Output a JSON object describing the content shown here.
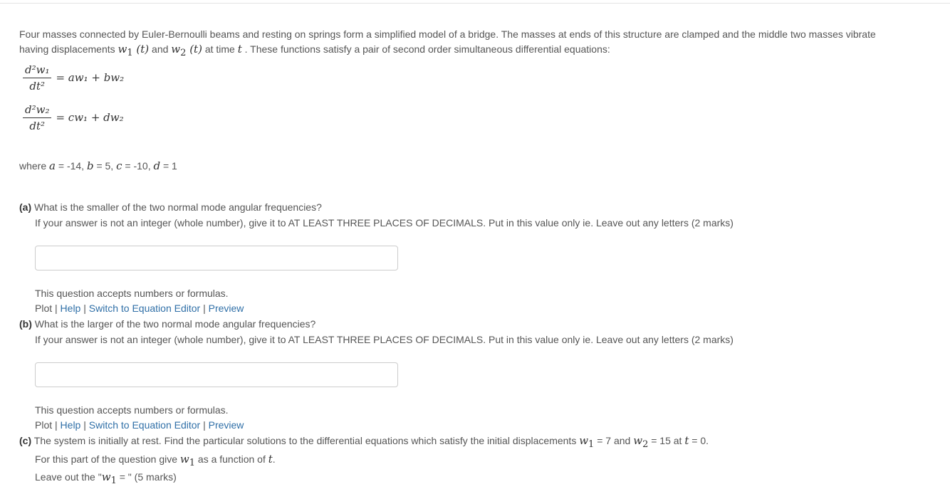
{
  "intro": {
    "line1": "Four masses connected by Euler-Bernoulli beams and resting on springs form a simplified model of a bridge. The masses at ends of this structure are clamped and the middle two masses vibrate",
    "line2_a": "having displacements ",
    "w1t": "w",
    "and": " and ",
    "at_time": " at time ",
    "t_var": "t",
    "line2_end": " . These functions satisfy a pair of second order simultaneous differential equations:"
  },
  "equations": [
    {
      "num": "d²w₁",
      "den": "dt²",
      "rhs": "= aw₁ + bw₂"
    },
    {
      "num": "d²w₂",
      "den": "dt²",
      "rhs": "= cw₁ + dw₂"
    }
  ],
  "where": {
    "prefix": "where ",
    "a_var": "a",
    "a_val": " = -14, ",
    "b_var": "b",
    "b_val": " = 5, ",
    "c_var": "c",
    "c_val": " = -10, ",
    "d_var": "d",
    "d_val": " = 1"
  },
  "part_a": {
    "label": "(a)",
    "question": " What is the smaller of the two normal mode angular frequencies?",
    "instruction": "If your answer is not an integer (whole number), give it to AT LEAST THREE PLACES OF DECIMALS. Put in this value only ie. Leave out any letters (2 marks)",
    "input_value": "",
    "hint": "This question accepts numbers or formulas."
  },
  "part_b": {
    "label": "(b)",
    "question": " What is the larger of the two normal mode angular frequencies?",
    "instruction": "If your answer is not an integer (whole number), give it to AT LEAST THREE PLACES OF DECIMALS. Put in this value only ie. Leave out any letters (2 marks)",
    "input_value": "",
    "hint": "This question accepts numbers or formulas."
  },
  "links": {
    "plot": "Plot",
    "help": "Help",
    "switch": "Switch to Equation Editor",
    "preview": "Preview",
    "sep": " | "
  },
  "part_c": {
    "label": "(c)",
    "question_a": " The system is initially at rest. Find the particular solutions to the differential equations which satisfy the initial displacements ",
    "w1": "w",
    "eq7": " = 7 and ",
    "w2": "w",
    "eq15": " = 15 at ",
    "t": "t",
    "eq0": " = 0.",
    "line2_a": "For this part of the question give ",
    "line2_b": " as a function of ",
    "line2_t": "t",
    "line2_end": ".",
    "line3_a": "Leave out the \"",
    "line3_b": " = \" (5 marks)"
  },
  "colors": {
    "text": "#555555",
    "link": "#2f6fa7",
    "border": "#cccccc"
  }
}
